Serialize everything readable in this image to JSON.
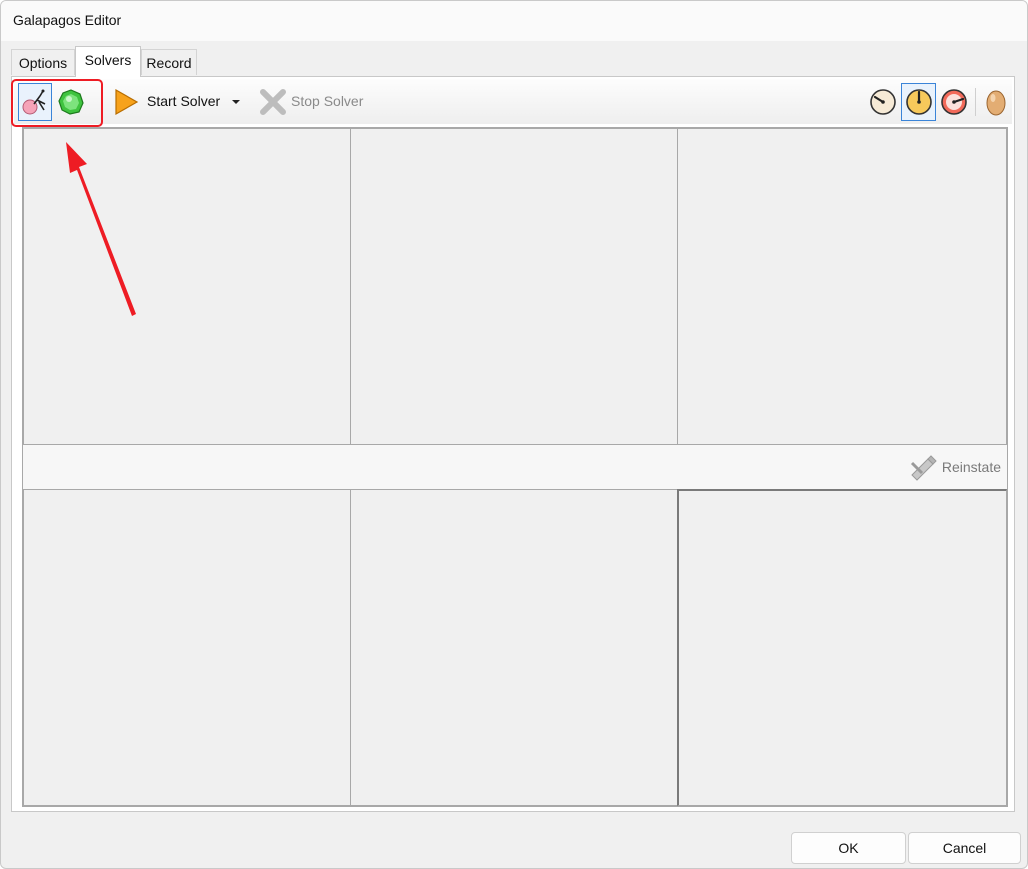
{
  "window": {
    "title": "Galapagos Editor"
  },
  "tabs": [
    {
      "label": "Options",
      "active": false
    },
    {
      "label": "Solvers",
      "active": true
    },
    {
      "label": "Record",
      "active": false
    }
  ],
  "toolbar": {
    "solver_modes": [
      {
        "icon": "genetic-solver-icon",
        "selected": true
      },
      {
        "icon": "annealing-solver-icon",
        "selected": false
      }
    ],
    "start_label": "Start Solver",
    "start_icon": "play-triangle-icon",
    "dropdown_icon": "chevron-down-icon",
    "stop_label": "Stop Solver",
    "stop_icon": "stop-x-icon",
    "speed_modes": [
      {
        "icon": "gauge-slow-icon",
        "selected": false
      },
      {
        "icon": "gauge-medium-icon",
        "selected": true
      },
      {
        "icon": "gauge-fast-icon",
        "selected": false
      }
    ],
    "egg_icon": "egg-icon"
  },
  "panels": {
    "reinstate_label": "Reinstate",
    "reinstate_icon": "reinstate-pencil-icon"
  },
  "buttons": {
    "ok": "OK",
    "cancel": "Cancel"
  },
  "annotation": {
    "color": "#ee1c24"
  }
}
